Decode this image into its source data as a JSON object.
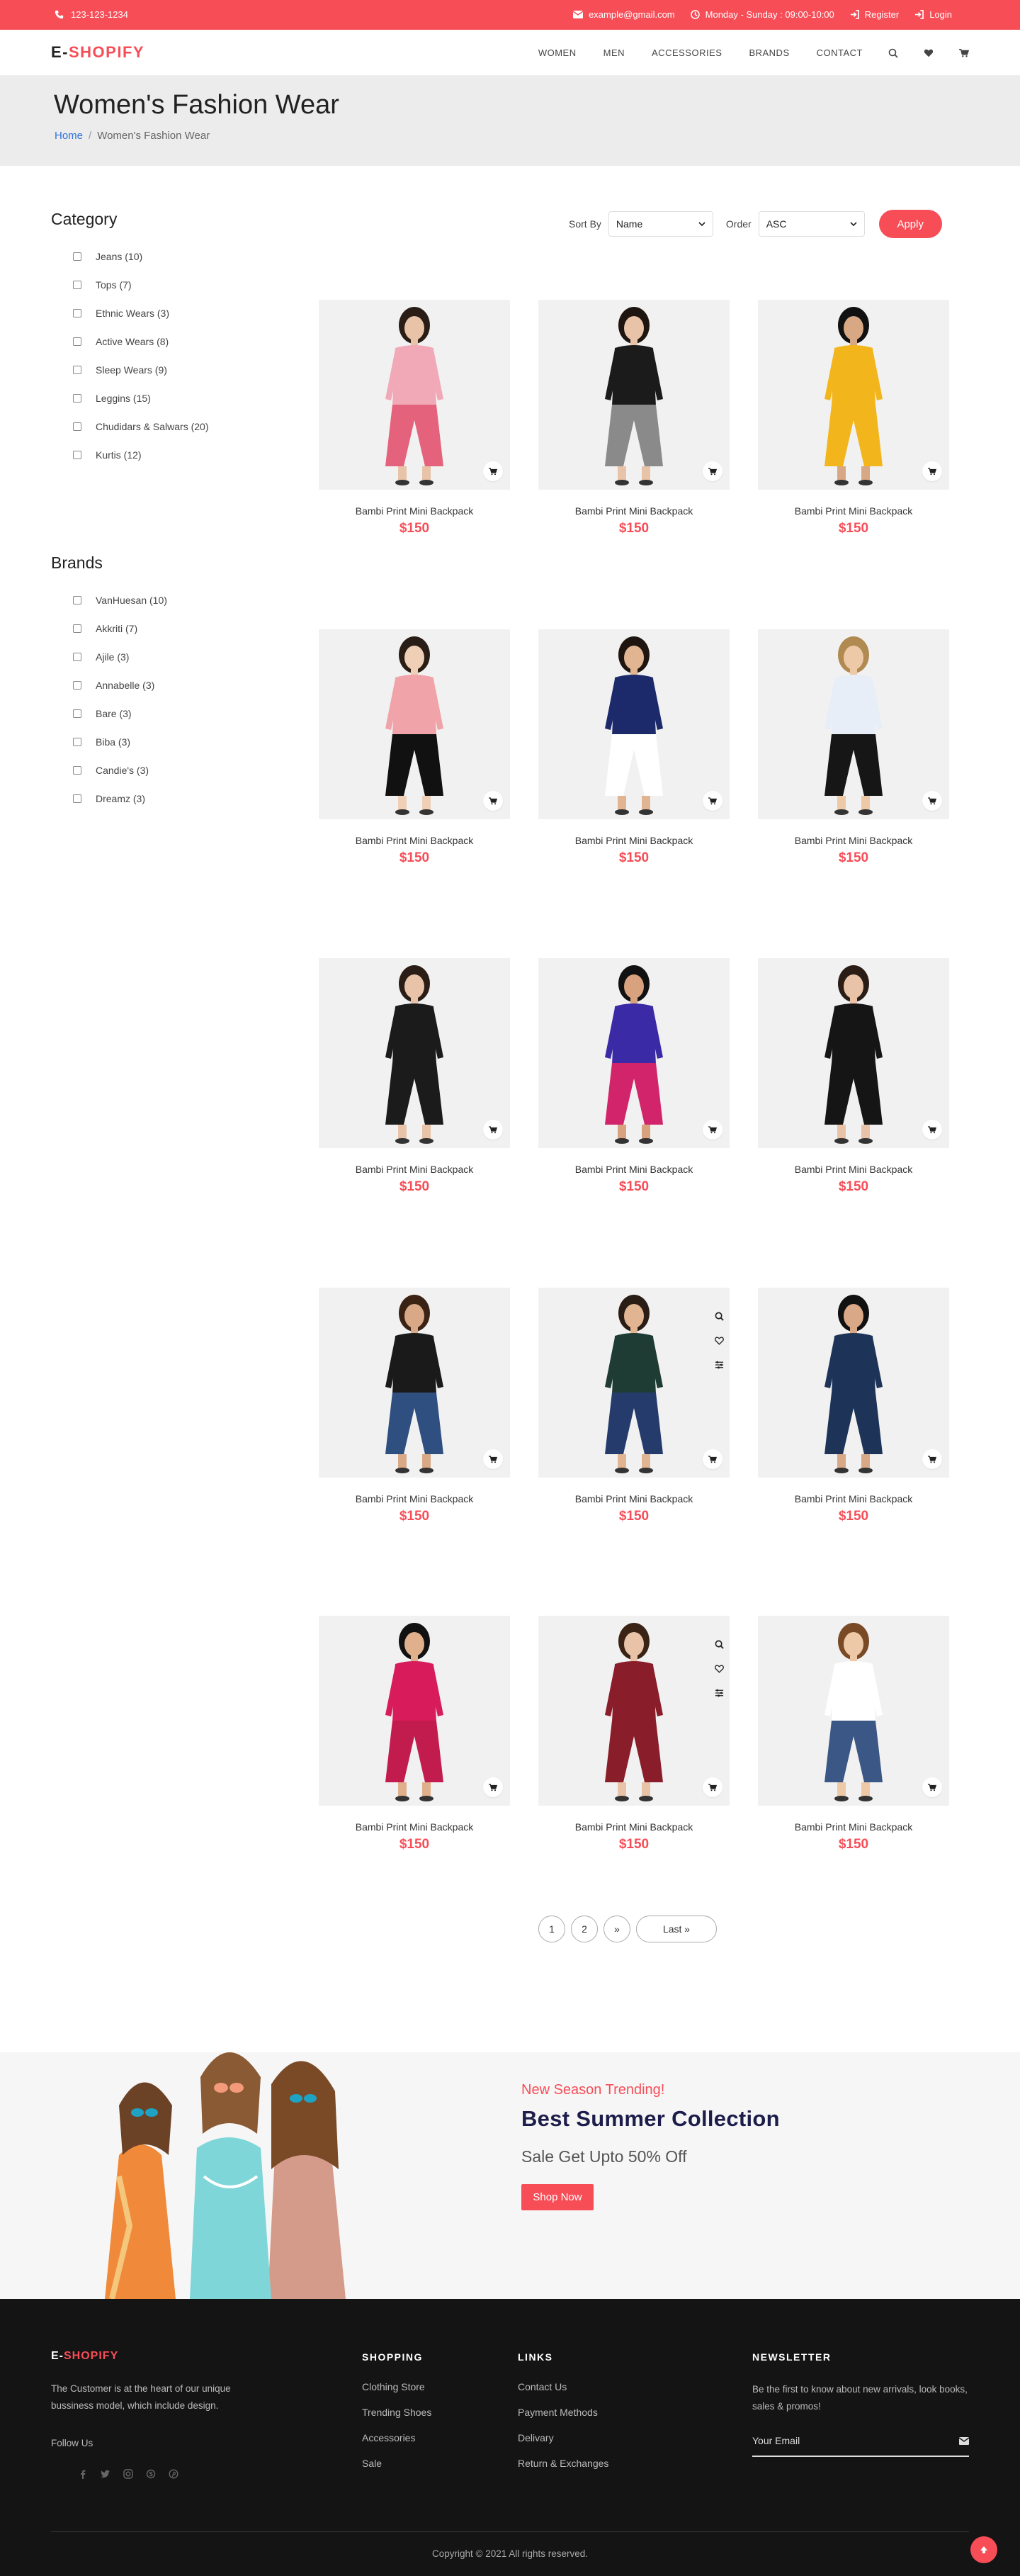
{
  "topbar": {
    "phone": "123-123-1234",
    "email": "example@gmail.com",
    "hours": "Monday - Sunday : 09:00-10:00",
    "register": "Register",
    "login": "Login"
  },
  "header": {
    "logo_prefix": "E-",
    "logo_main": "SHOPIFY",
    "nav": [
      "WOMEN",
      "MEN",
      "ACCESSORIES",
      "BRANDS",
      "CONTACT"
    ],
    "icons": [
      "search-icon",
      "heart-icon",
      "cart-icon"
    ]
  },
  "page": {
    "title": "Women's Fashion Wear",
    "breadcrumb_home": "Home",
    "breadcrumb_sep": "/",
    "breadcrumb_current": "Women's Fashion Wear"
  },
  "sidebar": {
    "category_title": "Category",
    "categories": [
      "Jeans (10)",
      "Tops (7)",
      "Ethnic Wears (3)",
      "Active Wears (8)",
      "Sleep Wears (9)",
      "Leggins (15)",
      "Chudidars & Salwars (20)",
      "Kurtis (12)"
    ],
    "brands_title": "Brands",
    "brands": [
      "VanHuesan (10)",
      "Akkriti (7)",
      "Ajile (3)",
      "Annabelle (3)",
      "Bare (3)",
      "Biba (3)",
      "Candie's (3)",
      "Dreamz (3)"
    ]
  },
  "sort": {
    "sort_by_label": "Sort By",
    "sort_by_value": "Name",
    "order_label": "Order",
    "order_value": "ASC",
    "apply_label": "Apply"
  },
  "products": [
    {
      "name": "Bambi Print Mini Backpack",
      "price": "$150",
      "top": "#f1a9b8",
      "bottom": "#e4627c",
      "skin": "#e8c3a8",
      "hair": "#2a1d16"
    },
    {
      "name": "Bambi Print Mini Backpack",
      "price": "$150",
      "top": "#1b1b1b",
      "bottom": "#8a8a8a",
      "skin": "#e8c3a8",
      "hair": "#1f1510"
    },
    {
      "name": "Bambi Print Mini Backpack",
      "price": "$150",
      "top": "#f2b51c",
      "bottom": "#f2b51c",
      "skin": "#d8a884",
      "hair": "#111111"
    },
    {
      "name": "Bambi Print Mini Backpack",
      "price": "$150",
      "top": "#f0a3a8",
      "bottom": "#111111",
      "skin": "#efcfb6",
      "hair": "#2a1d16"
    },
    {
      "name": "Bambi Print Mini Backpack",
      "price": "$150",
      "top": "#1c2a6b",
      "bottom": "#ffffff",
      "skin": "#e2b592",
      "hair": "#1f1510"
    },
    {
      "name": "Bambi Print Mini Backpack",
      "price": "$150",
      "top": "#e8eef7",
      "bottom": "#161616",
      "skin": "#edc9a8",
      "hair": "#b08a50"
    },
    {
      "name": "Bambi Print Mini Backpack",
      "price": "$150",
      "top": "#1b1b1b",
      "bottom": "#1b1b1b",
      "skin": "#e8c3a8",
      "hair": "#2a1d16"
    },
    {
      "name": "Bambi Print Mini Backpack",
      "price": "$150",
      "top": "#3b2aa6",
      "bottom": "#d1246a",
      "skin": "#d7a27d",
      "hair": "#111111"
    },
    {
      "name": "Bambi Print Mini Backpack",
      "price": "$150",
      "top": "#151515",
      "bottom": "#151515",
      "skin": "#e8c3a8",
      "hair": "#2a1d16"
    },
    {
      "name": "Bambi Print Mini Backpack",
      "price": "$150",
      "top": "#1a1a1a",
      "bottom": "#2f4f80",
      "skin": "#d9a887",
      "hair": "#3a2315"
    },
    {
      "name": "Bambi Print Mini Backpack",
      "price": "$150",
      "top": "#1f3c34",
      "bottom": "#243b6b",
      "skin": "#e2b592",
      "hair": "#2a1d16"
    },
    {
      "name": "Bambi Print Mini Backpack",
      "price": "$150",
      "top": "#1d3458",
      "bottom": "#1d3458",
      "skin": "#d9a887",
      "hair": "#111111"
    },
    {
      "name": "Bambi Print Mini Backpack",
      "price": "$150",
      "top": "#d81b5a",
      "bottom": "#c21c4f",
      "skin": "#e0b08c",
      "hair": "#111111"
    },
    {
      "name": "Bambi Print Mini Backpack",
      "price": "$150",
      "top": "#8a1d2a",
      "bottom": "#8a1d2a",
      "skin": "#e8c3a8",
      "hair": "#3a2315"
    },
    {
      "name": "Bambi Print Mini Backpack",
      "price": "$150",
      "top": "#ffffff",
      "bottom": "#3a5785",
      "skin": "#edc9a8",
      "hair": "#7a4a26"
    }
  ],
  "pagination": [
    "1",
    "2",
    "»",
    "Last »"
  ],
  "banner": {
    "trending": "New Season Trending!",
    "title": "Best Summer Collection",
    "subtitle": "Sale Get Upto 50% Off",
    "cta": "Shop Now"
  },
  "footer": {
    "logo_prefix": "E-",
    "logo_main": "SHOPIFY",
    "about": "The Customer is at the heart of our unique bussiness model, which include design.",
    "follow": "Follow Us",
    "social_icons": [
      "facebook-icon",
      "twitter-icon",
      "instagram-icon",
      "skype-icon",
      "pinterest-icon"
    ],
    "shopping_title": "SHOPPING",
    "shopping_links": [
      "Clothing Store",
      "Trending Shoes",
      "Accessories",
      "Sale"
    ],
    "links_title": "LINKS",
    "links": [
      "Contact Us",
      "Payment Methods",
      "Delivary",
      "Return & Exchanges"
    ],
    "newsletter_title": "NEWSLETTER",
    "newsletter_desc": "Be the first to know about new arrivals, look books, sales & promos!",
    "email_placeholder": "Your Email",
    "copyright": "Copyright © 2021 All rights reserved."
  },
  "colors": {
    "accent": "#f74d57",
    "footer_bg": "#141414",
    "title_navy": "#1d1d4b",
    "link_blue": "#3273dc"
  }
}
